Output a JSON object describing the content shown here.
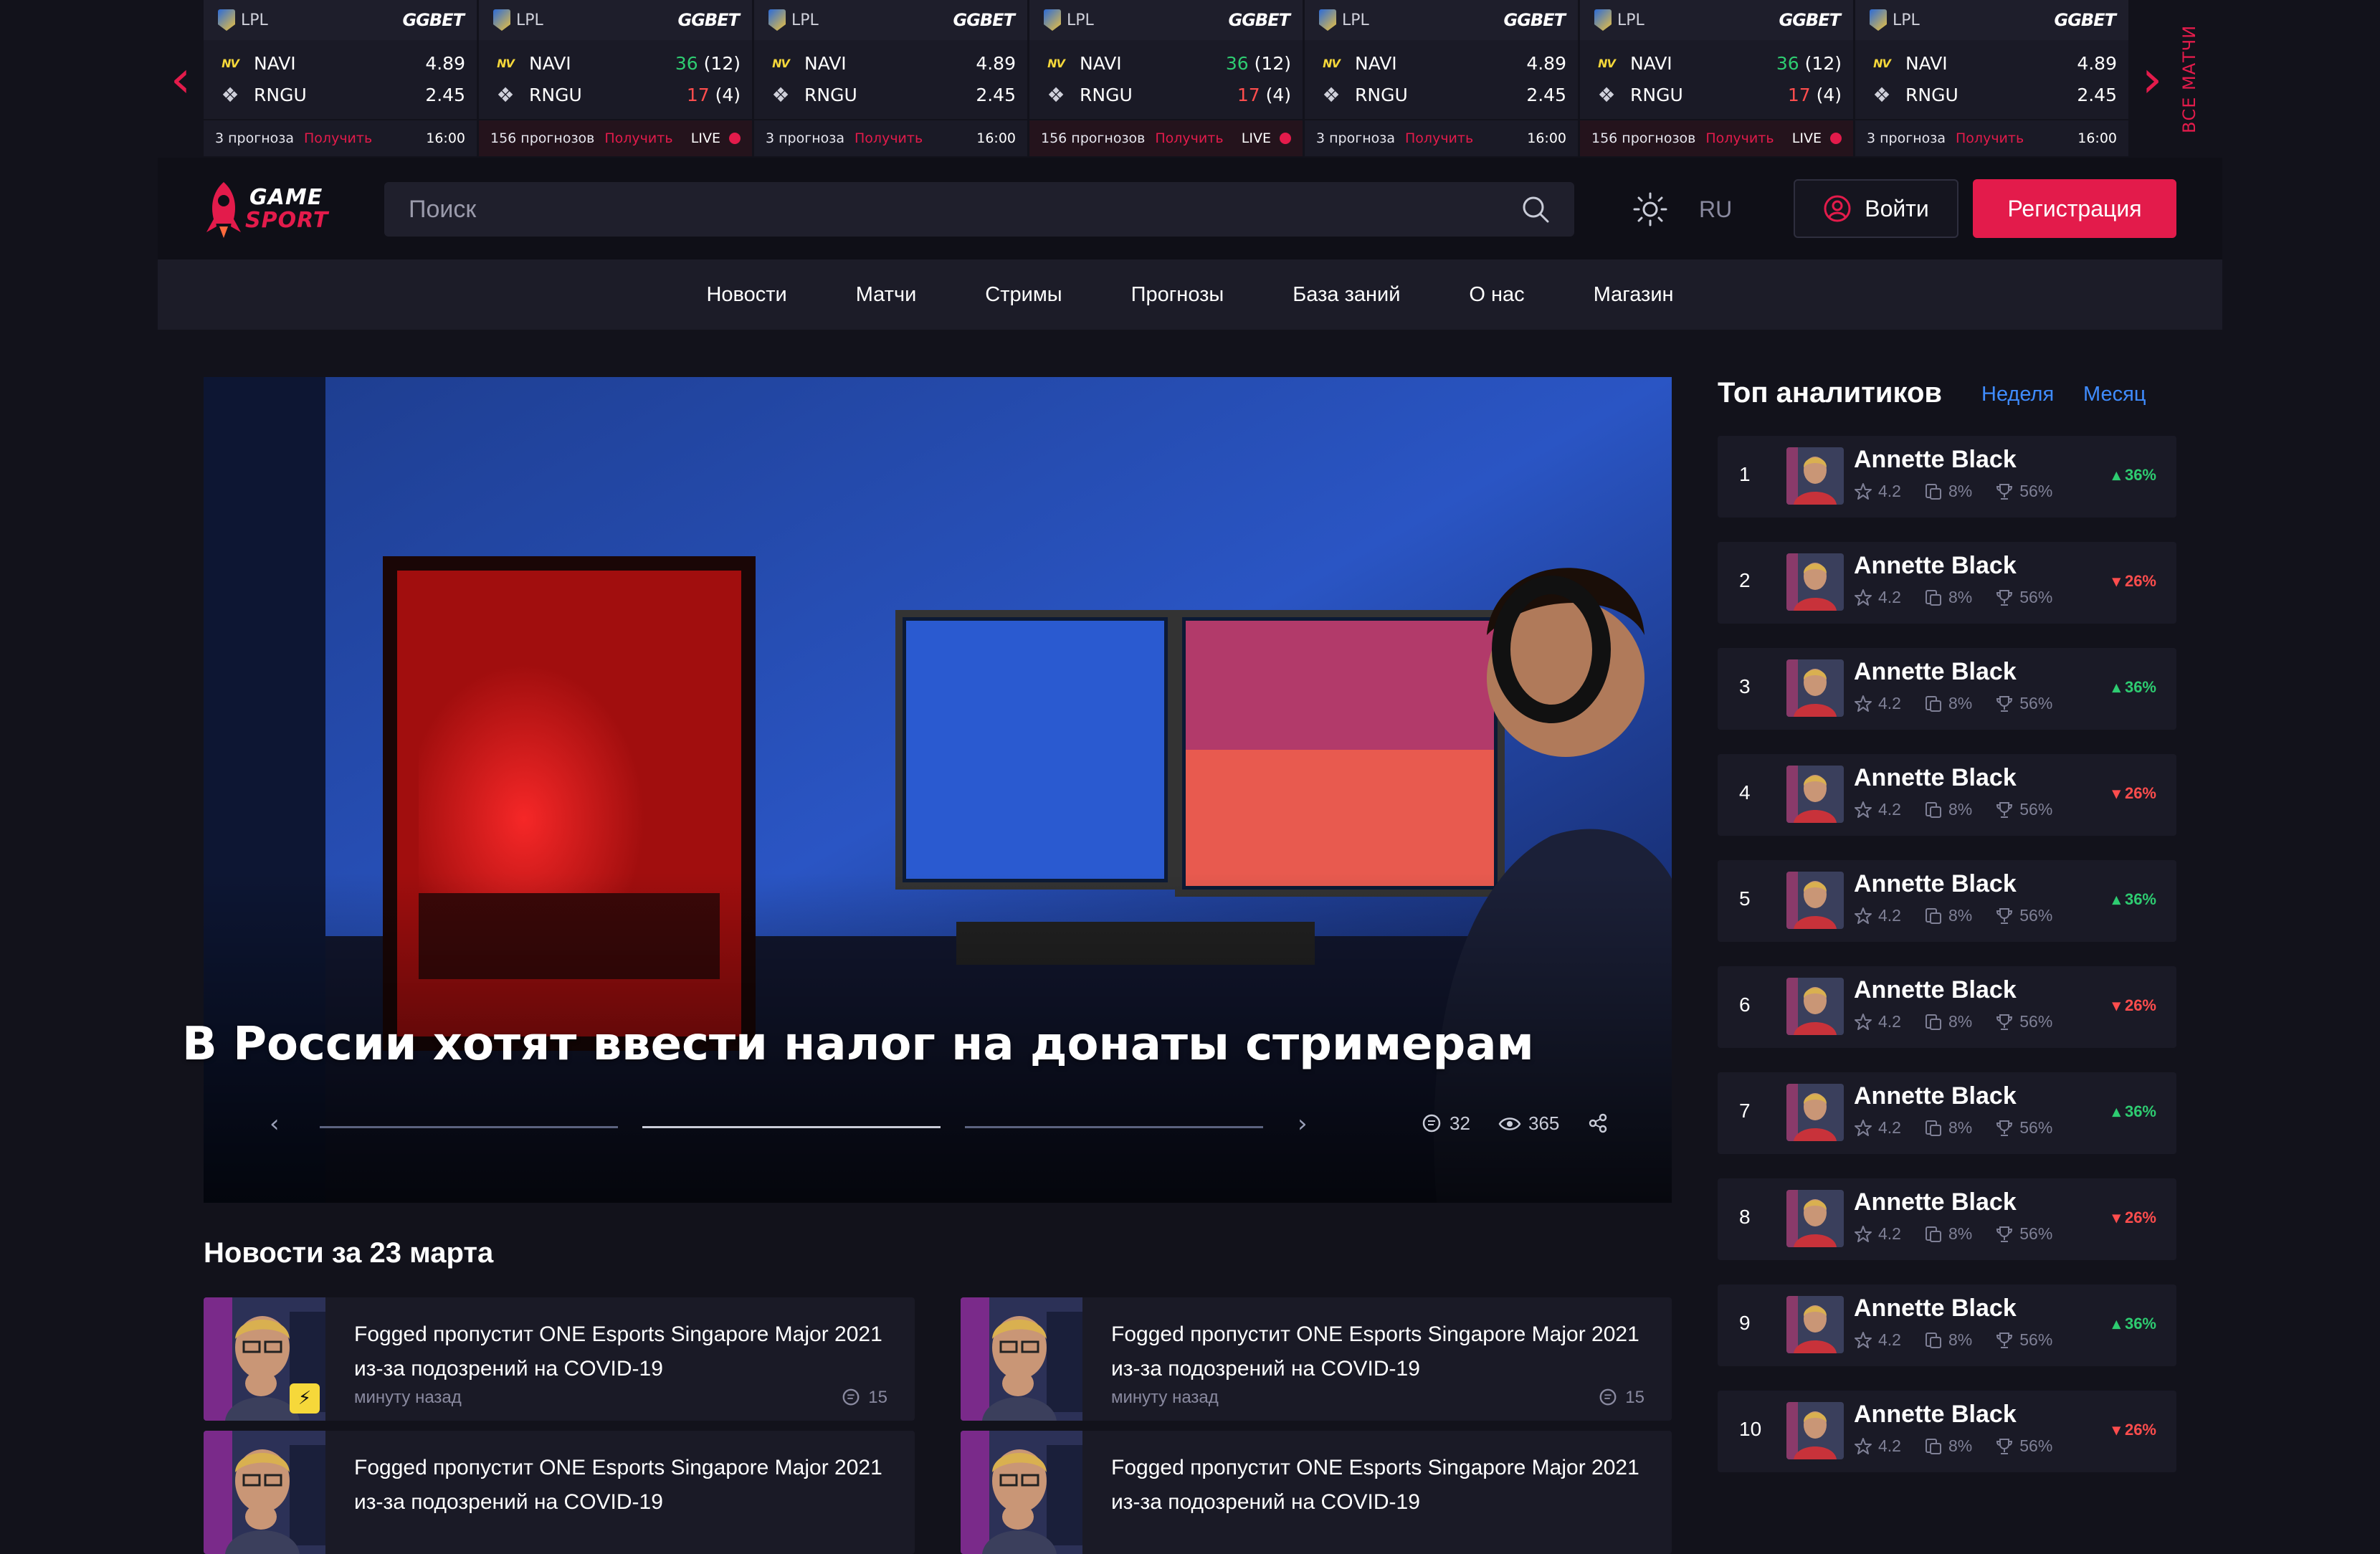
{
  "ticker": {
    "all_matches_label": "ВСЕ МАТЧИ",
    "cards": [
      {
        "league": "LPL",
        "bookmaker": "GGBET",
        "team1": "NAVI",
        "team2": "RNGU",
        "odd1": "4.89",
        "odd2": "2.45",
        "forecasts": "3 прогноза",
        "get_label": "Получить",
        "status": "16:00",
        "live": false
      },
      {
        "league": "LPL",
        "bookmaker": "GGBET",
        "team1": "NAVI",
        "team2": "RNGU",
        "score1": "36",
        "score1_sub": "(12)",
        "score2": "17",
        "score2_sub": "(4)",
        "forecasts": "156 прогнозов",
        "get_label": "Получить",
        "status": "LIVE",
        "live": true
      },
      {
        "league": "LPL",
        "bookmaker": "GGBET",
        "team1": "NAVI",
        "team2": "RNGU",
        "odd1": "4.89",
        "odd2": "2.45",
        "forecasts": "3 прогноза",
        "get_label": "Получить",
        "status": "16:00",
        "live": false
      },
      {
        "league": "LPL",
        "bookmaker": "GGBET",
        "team1": "NAVI",
        "team2": "RNGU",
        "score1": "36",
        "score1_sub": "(12)",
        "score2": "17",
        "score2_sub": "(4)",
        "forecasts": "156 прогнозов",
        "get_label": "Получить",
        "status": "LIVE",
        "live": true
      },
      {
        "league": "LPL",
        "bookmaker": "GGBET",
        "team1": "NAVI",
        "team2": "RNGU",
        "odd1": "4.89",
        "odd2": "2.45",
        "forecasts": "3 прогноза",
        "get_label": "Получить",
        "status": "16:00",
        "live": false
      },
      {
        "league": "LPL",
        "bookmaker": "GGBET",
        "team1": "NAVI",
        "team2": "RNGU",
        "score1": "36",
        "score1_sub": "(12)",
        "score2": "17",
        "score2_sub": "(4)",
        "forecasts": "156 прогнозов",
        "get_label": "Получить",
        "status": "LIVE",
        "live": true
      },
      {
        "league": "LPL",
        "bookmaker": "GGBET",
        "team1": "NAVI",
        "team2": "RNGU",
        "odd1": "4.89",
        "odd2": "2.45",
        "forecasts": "3 прогноза",
        "get_label": "Получить",
        "status": "16:00",
        "live": false
      }
    ]
  },
  "header": {
    "logo_line1": "GAME",
    "logo_line2": "SPORT",
    "search_placeholder": "Поиск",
    "lang": "RU",
    "login_label": "Войти",
    "register_label": "Регистрация"
  },
  "nav": [
    "Новости",
    "Матчи",
    "Стримы",
    "Прогнозы",
    "База заний",
    "О нас",
    "Магазин"
  ],
  "hero": {
    "title": "В России хотят ввести налог на донаты стримерам",
    "comments": "32",
    "views": "365"
  },
  "news": {
    "title": "Новости за 23 марта",
    "items": [
      {
        "text": "Fogged пропустит ONE Esports Singapore Major 2021 из-за подозрений на COVID-19",
        "time": "минуту назад",
        "comments": "15",
        "bolt": true
      },
      {
        "text": "Fogged пропустит ONE Esports Singapore Major 2021 из-за подозрений на COVID-19",
        "time": "минуту назад",
        "comments": "15",
        "bolt": false
      },
      {
        "text": "Fogged пропустит ONE Esports Singapore Major 2021 из-за подозрений на COVID-19",
        "time": "",
        "comments": "",
        "bolt": false
      },
      {
        "text": "Fogged пропустит ONE Esports Singapore Major 2021 из-за подозрений на COVID-19",
        "time": "",
        "comments": "",
        "bolt": false
      }
    ]
  },
  "analysts": {
    "title": "Топ аналитиков",
    "tabs": [
      "Неделя",
      "Месяц"
    ],
    "items": [
      {
        "rank": "1",
        "name": "Annette Black",
        "rating": "4.2",
        "roi": "8%",
        "win": "56%",
        "change": "36%",
        "trend": "up"
      },
      {
        "rank": "2",
        "name": "Annette Black",
        "rating": "4.2",
        "roi": "8%",
        "win": "56%",
        "change": "26%",
        "trend": "down"
      },
      {
        "rank": "3",
        "name": "Annette Black",
        "rating": "4.2",
        "roi": "8%",
        "win": "56%",
        "change": "36%",
        "trend": "up"
      },
      {
        "rank": "4",
        "name": "Annette Black",
        "rating": "4.2",
        "roi": "8%",
        "win": "56%",
        "change": "26%",
        "trend": "down"
      },
      {
        "rank": "5",
        "name": "Annette Black",
        "rating": "4.2",
        "roi": "8%",
        "win": "56%",
        "change": "36%",
        "trend": "up"
      },
      {
        "rank": "6",
        "name": "Annette Black",
        "rating": "4.2",
        "roi": "8%",
        "win": "56%",
        "change": "26%",
        "trend": "down"
      },
      {
        "rank": "7",
        "name": "Annette Black",
        "rating": "4.2",
        "roi": "8%",
        "win": "56%",
        "change": "36%",
        "trend": "up"
      },
      {
        "rank": "8",
        "name": "Annette Black",
        "rating": "4.2",
        "roi": "8%",
        "win": "56%",
        "change": "26%",
        "trend": "down"
      },
      {
        "rank": "9",
        "name": "Annette Black",
        "rating": "4.2",
        "roi": "8%",
        "win": "56%",
        "change": "36%",
        "trend": "up"
      },
      {
        "rank": "10",
        "name": "Annette Black",
        "rating": "4.2",
        "roi": "8%",
        "win": "56%",
        "change": "26%",
        "trend": "down"
      }
    ]
  },
  "colors": {
    "accent": "#e31b4b",
    "link": "#3f8cff",
    "up": "#2ecc71",
    "down": "#ff4d4d",
    "bg": "#12121b",
    "card": "#1a1a26"
  },
  "icons": [
    "search-icon",
    "sun-icon",
    "user-icon",
    "comment-icon",
    "eye-icon",
    "share-icon",
    "star-icon",
    "coins-icon",
    "trophy-icon",
    "chevron-left-icon",
    "chevron-right-icon",
    "bolt-icon"
  ]
}
